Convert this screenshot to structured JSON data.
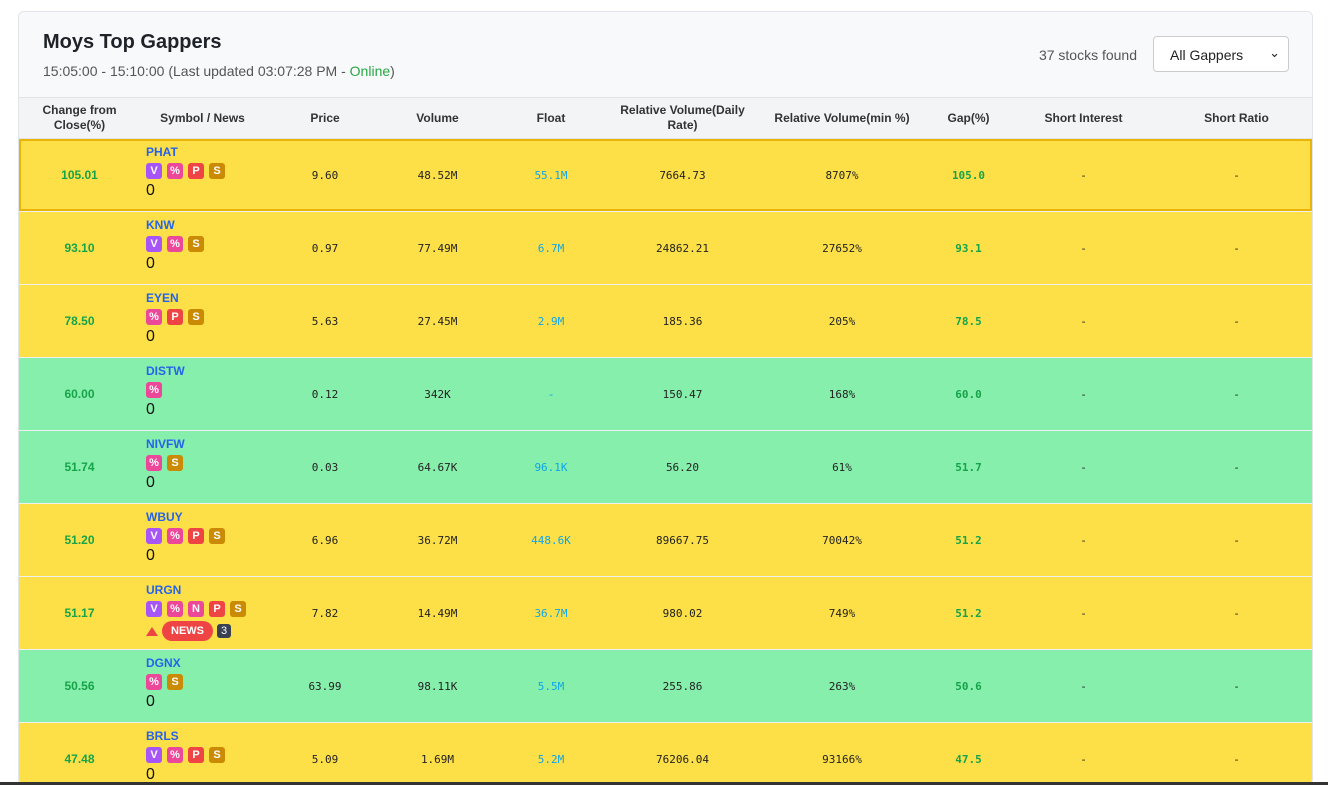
{
  "header": {
    "title": "Moys Top Gappers",
    "time_range": "15:05:00 - 15:10:00",
    "last_updated": "(Last updated 03:07:28 PM - ",
    "status": "Online",
    "status_close": ")",
    "count": "37 stocks found",
    "filter_value": "All Gappers"
  },
  "columns": [
    "Change from Close(%)",
    "Symbol / News",
    "Price",
    "Volume",
    "Float",
    "Relative Volume(Daily Rate)",
    "Relative Volume(min %)",
    "Gap(%)",
    "Short Interest",
    "Short Ratio"
  ],
  "rows": [
    {
      "change": "105.01",
      "symbol": "PHAT",
      "badges": [
        "V",
        "%",
        "P",
        "S"
      ],
      "zero": "0",
      "price": "9.60",
      "volume": "48.52M",
      "float": "55.1M",
      "rv_daily": "7664.73",
      "rv_min": "8707%",
      "gap": "105.0",
      "short_interest": "-",
      "short_ratio": "-",
      "color": "yellow"
    },
    {
      "change": "93.10",
      "symbol": "KNW",
      "badges": [
        "V",
        "%",
        "S"
      ],
      "zero": "0",
      "price": "0.97",
      "volume": "77.49M",
      "float": "6.7M",
      "rv_daily": "24862.21",
      "rv_min": "27652%",
      "gap": "93.1",
      "short_interest": "-",
      "short_ratio": "-",
      "color": "yellow"
    },
    {
      "change": "78.50",
      "symbol": "EYEN",
      "badges": [
        "%",
        "P",
        "S"
      ],
      "zero": "0",
      "price": "5.63",
      "volume": "27.45M",
      "float": "2.9M",
      "rv_daily": "185.36",
      "rv_min": "205%",
      "gap": "78.5",
      "short_interest": "-",
      "short_ratio": "-",
      "color": "yellow"
    },
    {
      "change": "60.00",
      "symbol": "DISTW",
      "badges": [
        "%"
      ],
      "zero": "0",
      "price": "0.12",
      "volume": "342K",
      "float": "-",
      "rv_daily": "150.47",
      "rv_min": "168%",
      "gap": "60.0",
      "short_interest": "-",
      "short_ratio": "-",
      "color": "green"
    },
    {
      "change": "51.74",
      "symbol": "NIVFW",
      "badges": [
        "%",
        "S"
      ],
      "zero": "0",
      "price": "0.03",
      "volume": "64.67K",
      "float": "96.1K",
      "rv_daily": "56.20",
      "rv_min": "61%",
      "gap": "51.7",
      "short_interest": "-",
      "short_ratio": "-",
      "color": "green"
    },
    {
      "change": "51.20",
      "symbol": "WBUY",
      "badges": [
        "V",
        "%",
        "P",
        "S"
      ],
      "zero": "0",
      "price": "6.96",
      "volume": "36.72M",
      "float": "448.6K",
      "rv_daily": "89667.75",
      "rv_min": "70042%",
      "gap": "51.2",
      "short_interest": "-",
      "short_ratio": "-",
      "color": "yellow"
    },
    {
      "change": "51.17",
      "symbol": "URGN",
      "badges": [
        "V",
        "%",
        "N",
        "P",
        "S"
      ],
      "news_label": "NEWS",
      "news_count": "3",
      "price": "7.82",
      "volume": "14.49M",
      "float": "36.7M",
      "rv_daily": "980.02",
      "rv_min": "749%",
      "gap": "51.2",
      "short_interest": "-",
      "short_ratio": "-",
      "color": "yellow"
    },
    {
      "change": "50.56",
      "symbol": "DGNX",
      "badges": [
        "%",
        "S"
      ],
      "zero": "0",
      "price": "63.99",
      "volume": "98.11K",
      "float": "5.5M",
      "rv_daily": "255.86",
      "rv_min": "263%",
      "gap": "50.6",
      "short_interest": "-",
      "short_ratio": "-",
      "color": "green"
    },
    {
      "change": "47.48",
      "symbol": "BRLS",
      "badges": [
        "V",
        "%",
        "P",
        "S"
      ],
      "zero": "0",
      "price": "5.09",
      "volume": "1.69M",
      "float": "5.2M",
      "rv_daily": "76206.04",
      "rv_min": "93166%",
      "gap": "47.5",
      "short_interest": "-",
      "short_ratio": "-",
      "color": "yellow"
    }
  ]
}
